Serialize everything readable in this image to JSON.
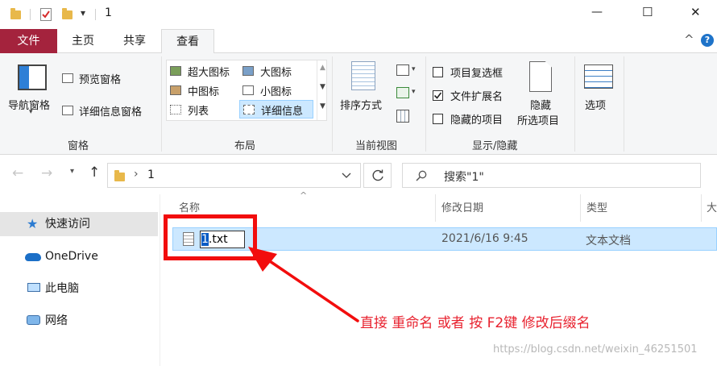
{
  "window": {
    "title": "1",
    "minimize_glyph": "—",
    "maximize_glyph": "☐",
    "close_glyph": "✕",
    "dropdown_glyph": "▾"
  },
  "tabs": [
    {
      "label": "文件"
    },
    {
      "label": "主页"
    },
    {
      "label": "共享"
    },
    {
      "label": "查看"
    }
  ],
  "ribbon": {
    "groups": {
      "panes": "窗格",
      "layout": "布局",
      "current_view": "当前视图",
      "show_hide": "显示/隐藏"
    },
    "nav_pane": "导航窗格",
    "preview_pane": "预览窗格",
    "details_pane": "详细信息窗格",
    "layout_items": [
      {
        "label": "超大图标"
      },
      {
        "label": "大图标"
      },
      {
        "label": "中图标"
      },
      {
        "label": "小图标"
      },
      {
        "label": "列表"
      },
      {
        "label": "详细信息"
      }
    ],
    "sort_by": "排序方式",
    "item_checkboxes": "项目复选框",
    "file_extensions": "文件扩展名",
    "hidden_items": "隐藏的项目",
    "hide_selected_line1": "隐藏",
    "hide_selected_line2": "所选项目",
    "options": "选项",
    "collapse_glyph": "^",
    "help_glyph": "?"
  },
  "address": {
    "path": "1",
    "separator": "›",
    "search_placeholder": "搜索\"1\""
  },
  "nav": [
    {
      "label": "快速访问"
    },
    {
      "label": "OneDrive"
    },
    {
      "label": "此电脑"
    },
    {
      "label": "网络"
    }
  ],
  "columns": [
    {
      "label": "名称"
    },
    {
      "label": "修改日期"
    },
    {
      "label": "类型"
    },
    {
      "label": "大"
    }
  ],
  "files": [
    {
      "name_selected": "1",
      "name_rest": ".txt",
      "modified": "2021/6/16 9:45",
      "type": "文本文档"
    }
  ],
  "annotation": "直接 重命名 或者 按 F2键 修改后缀名",
  "watermark": "https://blog.csdn.net/weixin_46251501",
  "colors": {
    "accent_file_tab": "#a4233d",
    "selection": "#cce8ff",
    "annotation_red": "#f20d0d"
  }
}
